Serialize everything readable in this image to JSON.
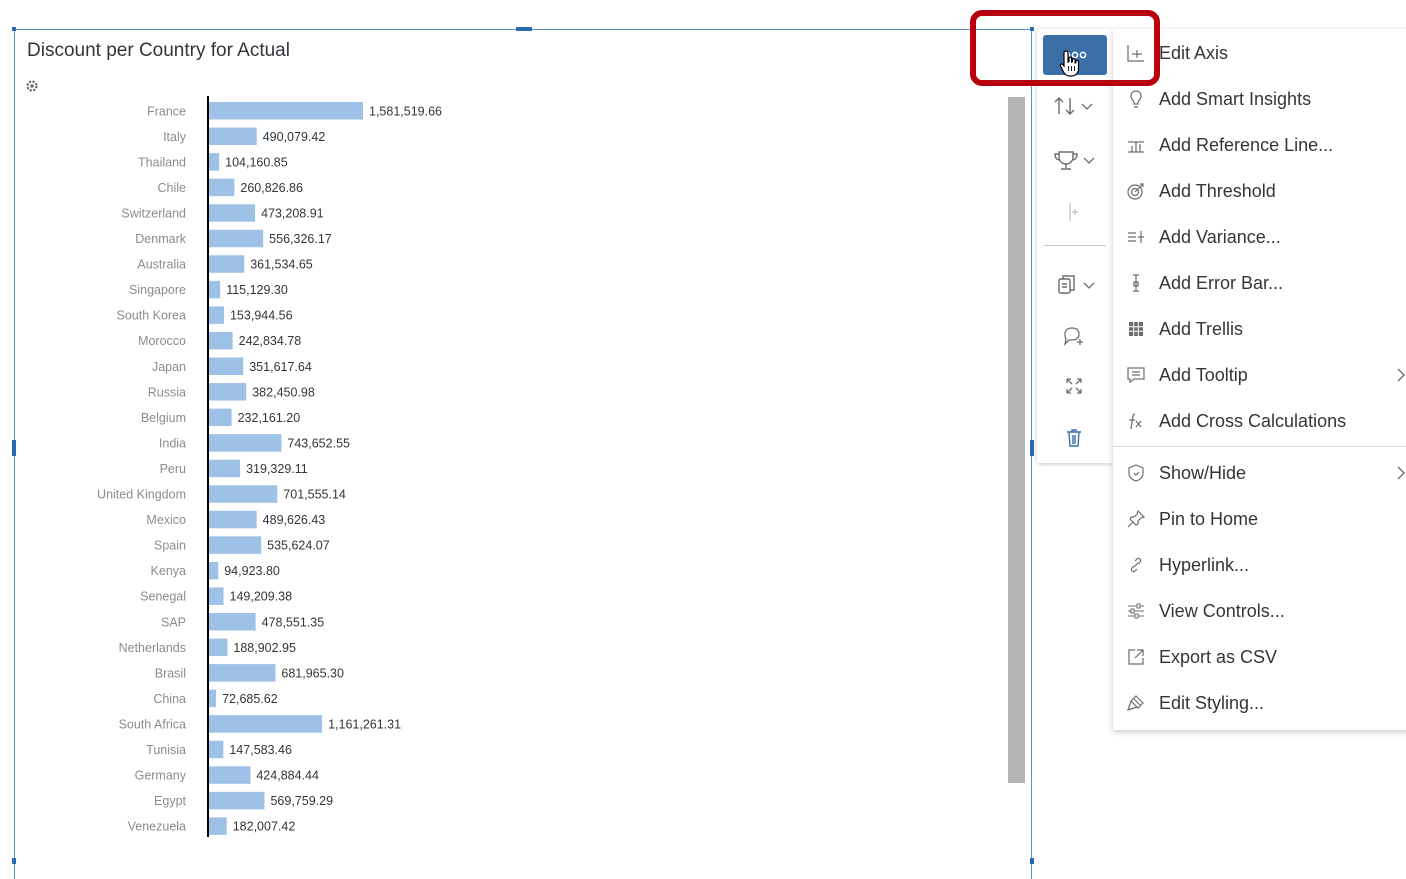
{
  "chart": {
    "title": "Discount per Country for Actual",
    "info_icon": "settings-cog-icon",
    "bar_color": "#9ec1e7"
  },
  "chart_data": {
    "type": "bar",
    "orientation": "horizontal",
    "categories": [
      "France",
      "Italy",
      "Thailand",
      "Chile",
      "Switzerland",
      "Denmark",
      "Australia",
      "Singapore",
      "South Korea",
      "Morocco",
      "Japan",
      "Russia",
      "Belgium",
      "India",
      "Peru",
      "United Kingdom",
      "Mexico",
      "Spain",
      "Kenya",
      "Senegal",
      "SAP",
      "Netherlands",
      "Brasil",
      "China",
      "South Africa",
      "Tunisia",
      "Germany",
      "Egypt",
      "Venezuela"
    ],
    "values": [
      1581519.66,
      490079.42,
      104160.85,
      260826.86,
      473208.91,
      556326.17,
      361534.65,
      115129.3,
      153944.56,
      242834.78,
      351617.64,
      382450.98,
      232161.2,
      743652.55,
      319329.11,
      701555.14,
      489626.43,
      535624.07,
      94923.8,
      149209.38,
      478551.35,
      188902.95,
      681965.3,
      72685.62,
      1161261.31,
      147583.46,
      424884.44,
      569759.29,
      182007.42
    ],
    "labels": [
      "1,581,519.66",
      "490,079.42",
      "104,160.85",
      "260,826.86",
      "473,208.91",
      "556,326.17",
      "361,534.65",
      "115,129.30",
      "153,944.56",
      "242,834.78",
      "351,617.64",
      "382,450.98",
      "232,161.20",
      "743,652.55",
      "319,329.11",
      "701,555.14",
      "489,626.43",
      "535,624.07",
      "94,923.80",
      "149,209.38",
      "478,551.35",
      "188,902.95",
      "681,965.30",
      "72,685.62",
      "1,161,261.31",
      "147,583.46",
      "424,884.44",
      "569,759.29",
      "182,007.42"
    ],
    "xlim": [
      0,
      1581519.66
    ]
  },
  "toolbar": {
    "items": [
      {
        "name": "more-options-button",
        "icon": "more-icon"
      },
      {
        "name": "sort-button",
        "icon": "sort-icon"
      },
      {
        "name": "rank-button",
        "icon": "trophy-icon"
      },
      {
        "name": "add-dimension-button",
        "icon": "drill-icon"
      },
      {
        "name": "copy-button",
        "icon": "copy-icon"
      },
      {
        "name": "add-comment-button",
        "icon": "comment-add-icon"
      },
      {
        "name": "fullscreen-button",
        "icon": "fullscreen-icon"
      },
      {
        "name": "delete-button",
        "icon": "trash-icon"
      }
    ]
  },
  "menu": {
    "items": [
      {
        "label": "Edit Axis",
        "icon": "axis-icon"
      },
      {
        "label": "Add Smart Insights",
        "icon": "lightbulb-icon"
      },
      {
        "label": "Add Reference Line...",
        "icon": "reference-line-icon"
      },
      {
        "label": "Add Threshold",
        "icon": "target-icon"
      },
      {
        "label": "Add Variance...",
        "icon": "variance-icon"
      },
      {
        "label": "Add Error Bar...",
        "icon": "error-bar-icon"
      },
      {
        "label": "Add Trellis",
        "icon": "grid-icon"
      },
      {
        "label": "Add Tooltip",
        "icon": "tooltip-icon",
        "submenu": true
      },
      {
        "label": "Add Cross Calculations",
        "icon": "function-icon"
      },
      {
        "label": "Show/Hide",
        "icon": "shield-icon",
        "submenu": true
      },
      {
        "label": "Pin to Home",
        "icon": "pin-icon"
      },
      {
        "label": "Hyperlink...",
        "icon": "link-icon"
      },
      {
        "label": "View Controls...",
        "icon": "controls-icon"
      },
      {
        "label": "Export as CSV",
        "icon": "export-icon"
      },
      {
        "label": "Edit Styling...",
        "icon": "paint-icon"
      }
    ]
  },
  "colors": {
    "accent": "#3a6fa8",
    "highlight": "#b8000f"
  }
}
